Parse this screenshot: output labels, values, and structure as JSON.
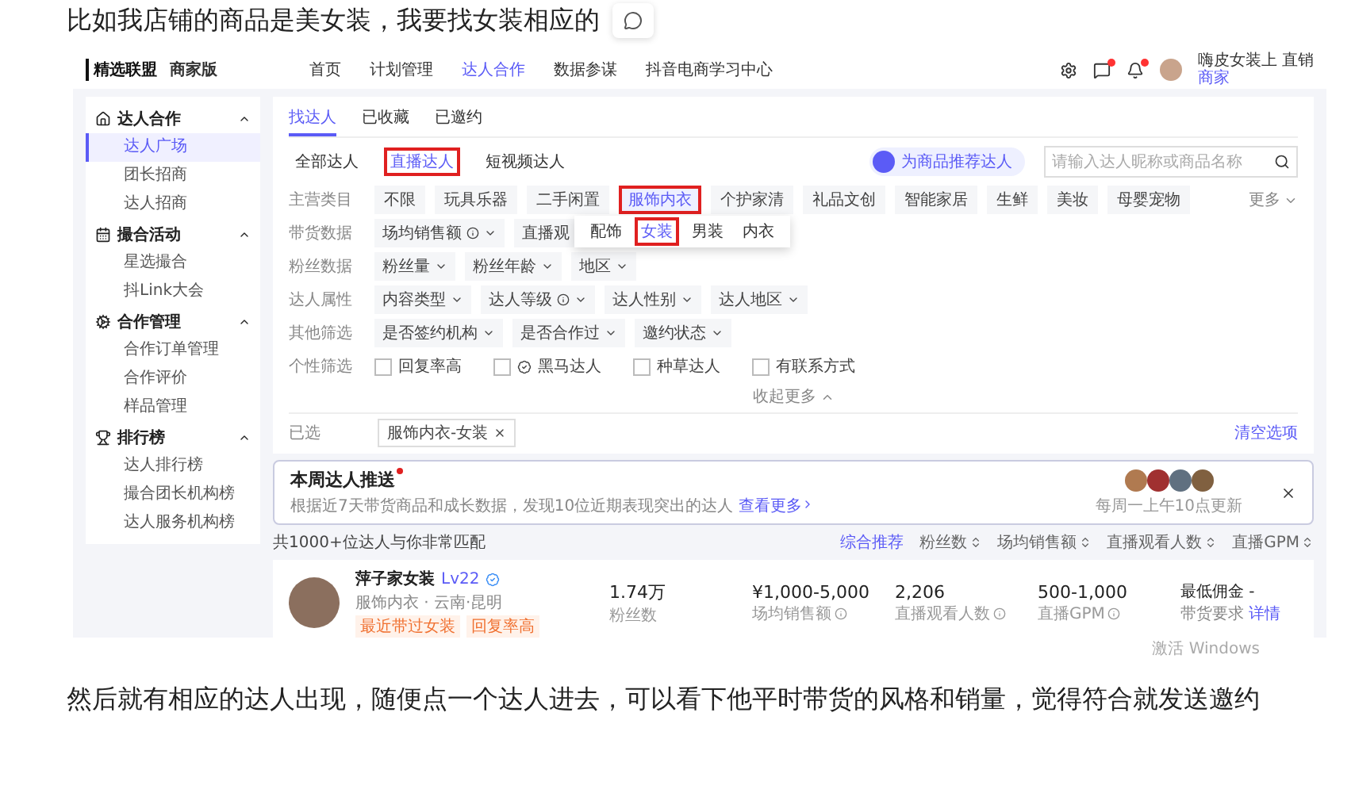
{
  "intro_text": "比如我店铺的商品是美女装，我要找女装相应的",
  "screenshot": {
    "header": {
      "logo": "精选联盟",
      "edition": "商家版",
      "nav": [
        {
          "label": "首页",
          "selected": false
        },
        {
          "label": "计划管理",
          "selected": false
        },
        {
          "label": "达人合作",
          "selected": true
        },
        {
          "label": "数据参谋",
          "selected": false
        },
        {
          "label": "抖音电商学习中心",
          "selected": false
        }
      ],
      "user_name": "嗨皮女装上 直销",
      "user_role": "商家"
    },
    "sidebar": [
      {
        "label": "达人合作",
        "kind": "home",
        "expanded": true,
        "items": [
          {
            "label": "达人广场",
            "selected": true
          },
          {
            "label": "团长招商",
            "selected": false
          },
          {
            "label": "达人招商",
            "selected": false
          }
        ]
      },
      {
        "label": "撮合活动",
        "kind": "calendar",
        "expanded": true,
        "items": [
          {
            "label": "星选撮合",
            "selected": false
          },
          {
            "label": "抖Link大会",
            "selected": false
          }
        ]
      },
      {
        "label": "合作管理",
        "kind": "gear",
        "expanded": true,
        "items": [
          {
            "label": "合作订单管理",
            "selected": false
          },
          {
            "label": "合作评价",
            "selected": false
          },
          {
            "label": "样品管理",
            "selected": false
          }
        ]
      },
      {
        "label": "排行榜",
        "kind": "trophy",
        "expanded": true,
        "items": [
          {
            "label": "达人排行榜",
            "selected": false
          },
          {
            "label": "撮合团长机构榜",
            "selected": false
          },
          {
            "label": "达人服务机构榜",
            "selected": false
          }
        ]
      }
    ],
    "tabs": [
      {
        "label": "找达人",
        "selected": true
      },
      {
        "label": "已收藏",
        "selected": false
      },
      {
        "label": "已邀约",
        "selected": false
      }
    ],
    "subtabs": [
      {
        "label": "全部达人",
        "selected": false,
        "highlighted": false
      },
      {
        "label": "直播达人",
        "selected": true,
        "highlighted": true
      },
      {
        "label": "短视频达人",
        "selected": false,
        "highlighted": false
      }
    ],
    "recommend_button": "为商品推荐达人",
    "search": {
      "placeholder": "请输入达人昵称或商品名称"
    },
    "filters": [
      {
        "label": "主营类目",
        "kind": "chips",
        "more": "更多",
        "options": [
          {
            "label": "不限",
            "selected": false,
            "highlighted": false
          },
          {
            "label": "玩具乐器",
            "selected": false,
            "highlighted": false
          },
          {
            "label": "二手闲置",
            "selected": false,
            "highlighted": false
          },
          {
            "label": "服饰内衣",
            "selected": true,
            "highlighted": true
          },
          {
            "label": "个护家清",
            "selected": false,
            "highlighted": false
          },
          {
            "label": "礼品文创",
            "selected": false,
            "highlighted": false
          },
          {
            "label": "智能家居",
            "selected": false,
            "highlighted": false
          },
          {
            "label": "生鲜",
            "selected": false,
            "highlighted": false
          },
          {
            "label": "美妆",
            "selected": false,
            "highlighted": false
          },
          {
            "label": "母婴宠物",
            "selected": false,
            "highlighted": false
          }
        ]
      },
      {
        "label": "带货数据",
        "kind": "selects",
        "options": [
          {
            "label": "场均销售额",
            "info": true
          },
          {
            "label": "直播观",
            "info": false
          }
        ]
      },
      {
        "label": "粉丝数据",
        "kind": "selects",
        "options": [
          {
            "label": "粉丝量",
            "info": false
          },
          {
            "label": "粉丝年龄",
            "info": false
          },
          {
            "label": "地区",
            "info": false
          }
        ]
      },
      {
        "label": "达人属性",
        "kind": "selects",
        "options": [
          {
            "label": "内容类型",
            "info": false
          },
          {
            "label": "达人等级",
            "info": true
          },
          {
            "label": "达人性别",
            "info": false
          },
          {
            "label": "达人地区",
            "info": false
          }
        ]
      },
      {
        "label": "其他筛选",
        "kind": "selects",
        "options": [
          {
            "label": "是否签约机构",
            "info": false
          },
          {
            "label": "是否合作过",
            "info": false
          },
          {
            "label": "邀约状态",
            "info": false
          }
        ]
      },
      {
        "label": "个性筛选",
        "kind": "checks",
        "options": [
          {
            "label": "回复率高",
            "checked": false,
            "badge": false
          },
          {
            "label": "黑马达人",
            "checked": false,
            "badge": true
          },
          {
            "label": "种草达人",
            "checked": false,
            "badge": false
          },
          {
            "label": "有联系方式",
            "checked": false,
            "badge": false
          }
        ]
      }
    ],
    "popup": {
      "options": [
        {
          "label": "配饰",
          "selected": false,
          "highlighted": false
        },
        {
          "label": "女装",
          "selected": true,
          "highlighted": true
        },
        {
          "label": "男装",
          "selected": false,
          "highlighted": false
        },
        {
          "label": "内衣",
          "selected": false,
          "highlighted": false
        }
      ]
    },
    "collapse": "收起更多",
    "chosen": {
      "label": "已选",
      "chips": [
        "服饰内衣-女装"
      ],
      "clear": "清空选项"
    },
    "push": {
      "title": "本周达人推送",
      "text": "根据近7天带货商品和成长数据，发现10位近期表现突出的达人",
      "link": "查看更多",
      "new": true,
      "note": "每周一上午10点更新"
    },
    "result_count": "共1000+位达人与你非常匹配",
    "sorts": [
      {
        "label": "综合推荐",
        "selected": true
      },
      {
        "label": "粉丝数",
        "selected": false
      },
      {
        "label": "场均销售额",
        "selected": false
      },
      {
        "label": "直播观看人数",
        "selected": false
      },
      {
        "label": "直播GPM",
        "selected": false
      }
    ],
    "creators": [
      {
        "name": "萍子家女装",
        "level": "Lv22",
        "meta": "服饰内衣 · 云南·昆明",
        "tags": [
          "最近带过女装",
          "回复率高"
        ],
        "stats": [
          {
            "value": "1.74万",
            "label": "粉丝数",
            "info": false
          },
          {
            "value": "¥1,000-5,000",
            "label": "场均销售额",
            "info": true
          },
          {
            "value": "2,206",
            "label": "直播观看人数",
            "info": true
          },
          {
            "value": "500-1,000",
            "label": "直播GPM",
            "info": true
          }
        ],
        "commission": "最低佣金 -",
        "requirement": "带货要求",
        "requirement_link": "详情"
      }
    ]
  },
  "windows_watermark": "激活 Windows",
  "outro_text": "然后就有相应的达人出现，随便点一个达人进去，可以看下他平时带货的风格和销量，觉得符合就发送邀约"
}
